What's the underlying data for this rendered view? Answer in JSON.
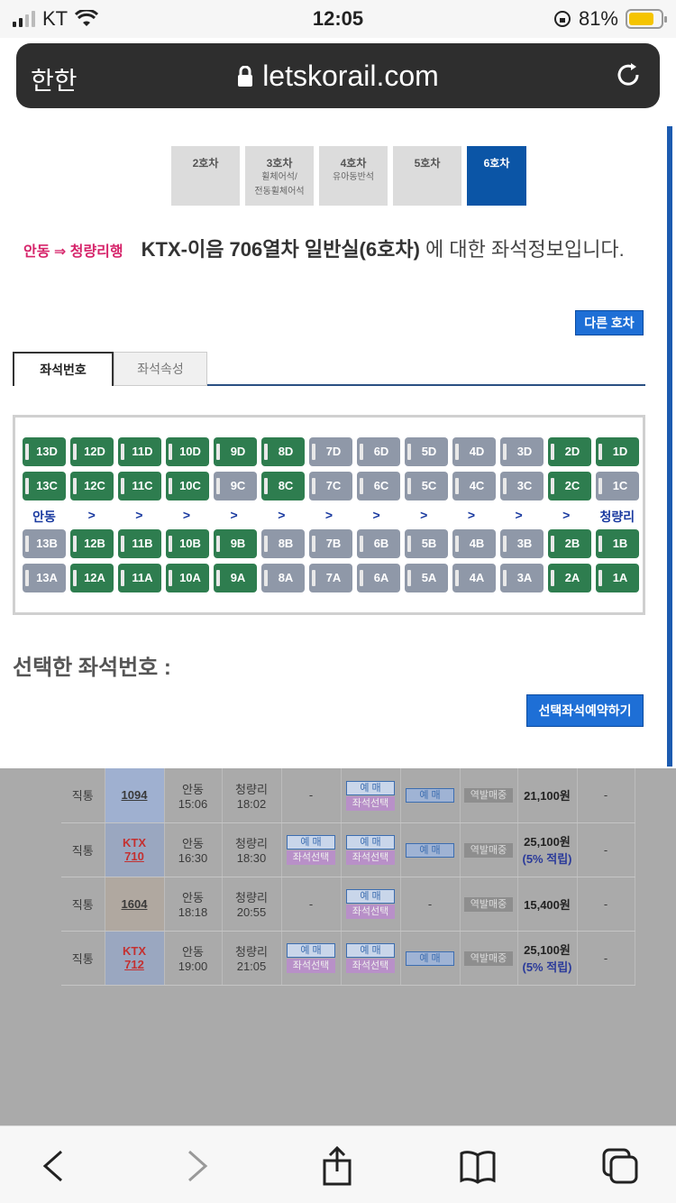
{
  "status": {
    "carrier": "KT",
    "time": "12:05",
    "battery": "81%"
  },
  "browser": {
    "aa": "한한",
    "url": "letskorail.com"
  },
  "car_tabs": [
    {
      "label": "2호차",
      "sub": ""
    },
    {
      "label": "3호차",
      "sub": "휠체어석/",
      "sub2": "전동휠체어석"
    },
    {
      "label": "4호차",
      "sub": "유아동반석",
      "sub2": ""
    },
    {
      "label": "5호차",
      "sub": "",
      "sub2": ""
    },
    {
      "label": "6호차",
      "sub": "",
      "sub2": ""
    }
  ],
  "info": {
    "route": "안동 ⇒ 청량리행",
    "train": "KTX-이음 706열차   일반실(6호차)",
    "suffix": " 에 대한 좌석정보입니다."
  },
  "other_car_button": "다른 호차",
  "seat_tabs": {
    "number": "좌석번호",
    "attr": "좌석속성"
  },
  "aisle": {
    "left": "안동",
    "right": "청량리",
    "arrow": ">"
  },
  "seat_rows": {
    "D": [
      [
        "13D",
        "a"
      ],
      [
        "12D",
        "a"
      ],
      [
        "11D",
        "a"
      ],
      [
        "10D",
        "a"
      ],
      [
        "9D",
        "a"
      ],
      [
        "8D",
        "a"
      ],
      [
        "7D",
        "s"
      ],
      [
        "6D",
        "s"
      ],
      [
        "5D",
        "s"
      ],
      [
        "4D",
        "s"
      ],
      [
        "3D",
        "s"
      ],
      [
        "2D",
        "a"
      ],
      [
        "1D",
        "a"
      ]
    ],
    "C": [
      [
        "13C",
        "a"
      ],
      [
        "12C",
        "a"
      ],
      [
        "11C",
        "a"
      ],
      [
        "10C",
        "a"
      ],
      [
        "9C",
        "s"
      ],
      [
        "8C",
        "a"
      ],
      [
        "7C",
        "s"
      ],
      [
        "6C",
        "s"
      ],
      [
        "5C",
        "s"
      ],
      [
        "4C",
        "s"
      ],
      [
        "3C",
        "s"
      ],
      [
        "2C",
        "a"
      ],
      [
        "1C",
        "s"
      ]
    ],
    "B": [
      [
        "13B",
        "s"
      ],
      [
        "12B",
        "a"
      ],
      [
        "11B",
        "a"
      ],
      [
        "10B",
        "a"
      ],
      [
        "9B",
        "a"
      ],
      [
        "8B",
        "s"
      ],
      [
        "7B",
        "s"
      ],
      [
        "6B",
        "s"
      ],
      [
        "5B",
        "s"
      ],
      [
        "4B",
        "s"
      ],
      [
        "3B",
        "s"
      ],
      [
        "2B",
        "a"
      ],
      [
        "1B",
        "a"
      ]
    ],
    "A": [
      [
        "13A",
        "s"
      ],
      [
        "12A",
        "a"
      ],
      [
        "11A",
        "a"
      ],
      [
        "10A",
        "a"
      ],
      [
        "9A",
        "a"
      ],
      [
        "8A",
        "s"
      ],
      [
        "7A",
        "s"
      ],
      [
        "6A",
        "s"
      ],
      [
        "5A",
        "s"
      ],
      [
        "4A",
        "s"
      ],
      [
        "3A",
        "s"
      ],
      [
        "2A",
        "a"
      ],
      [
        "1A",
        "a"
      ]
    ]
  },
  "selected_label": "선택한 좌석번호 :",
  "reserve_button": "선택좌석예약하기",
  "rows": [
    {
      "type": "직통",
      "train": "1094",
      "dep": "안동",
      "dep_t": "15:06",
      "arr": "청량리",
      "arr_t": "18:02",
      "price": "21,100원",
      "price2": ""
    },
    {
      "type": "직통",
      "train": "KTX",
      "train2": "710",
      "dep": "안동",
      "dep_t": "16:30",
      "arr": "청량리",
      "arr_t": "18:30",
      "price": "25,100원",
      "price2": "(5% 적립)"
    },
    {
      "type": "직통",
      "train": "1604",
      "dep": "안동",
      "dep_t": "18:18",
      "arr": "청량리",
      "arr_t": "20:55",
      "price": "15,400원",
      "price2": ""
    },
    {
      "type": "직통",
      "train": "KTX",
      "train2": "712",
      "dep": "안동",
      "dep_t": "19:00",
      "arr": "청량리",
      "arr_t": "21:05",
      "price": "25,100원",
      "price2": "(5% 적립)"
    }
  ],
  "pills": {
    "buy": "예 매",
    "seat": "좌석선택",
    "station": "역발매중",
    "dash": "-"
  }
}
